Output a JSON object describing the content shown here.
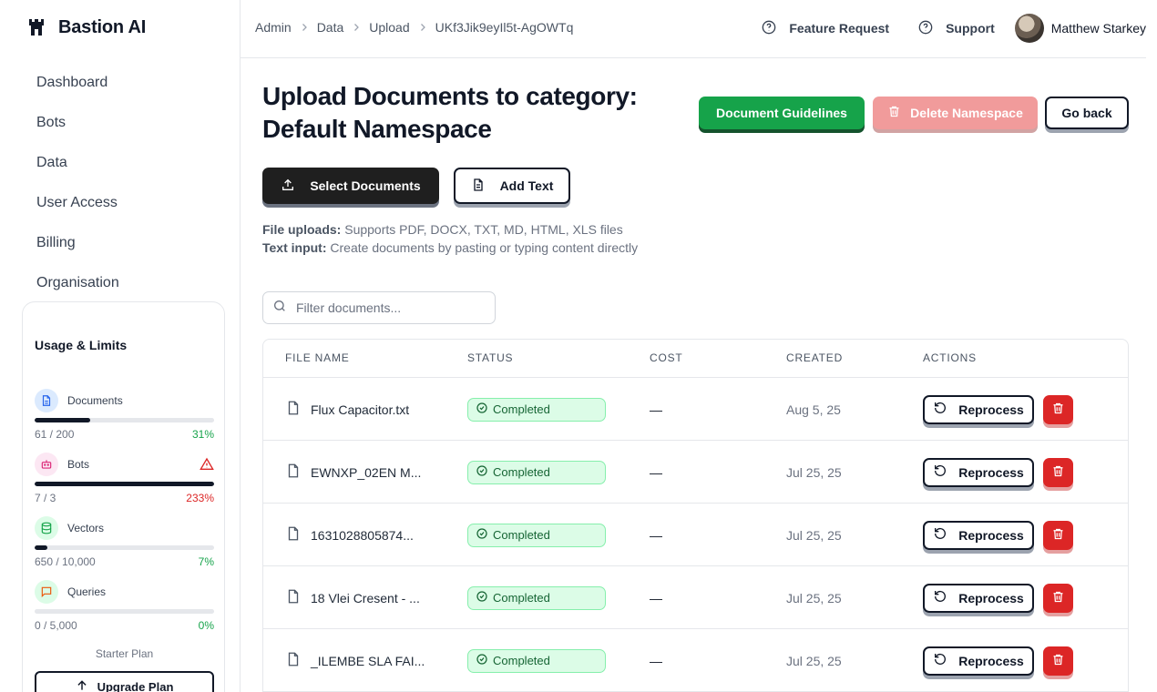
{
  "brand": {
    "name": "Bastion AI"
  },
  "nav": [
    "Dashboard",
    "Bots",
    "Data",
    "User Access",
    "Billing",
    "Organisation"
  ],
  "usage": {
    "title": "Usage & Limits",
    "metrics": [
      {
        "label": "Documents",
        "count": "61 / 200",
        "pct": "31%",
        "fill": 31,
        "icon": "document-icon",
        "warning": false
      },
      {
        "label": "Bots",
        "count": "7 / 3",
        "pct": "233%",
        "fill": 100,
        "icon": "bot-icon",
        "warning": true
      },
      {
        "label": "Vectors",
        "count": "650 / 10,000",
        "pct": "7%",
        "fill": 7,
        "icon": "database-icon",
        "warning": false
      },
      {
        "label": "Queries",
        "count": "0 / 5,000",
        "pct": "0%",
        "fill": 0,
        "icon": "chat-icon",
        "warning": false
      }
    ],
    "plan": "Starter Plan",
    "upgrade_label": "Upgrade Plan"
  },
  "breadcrumb": [
    "Admin",
    "Data",
    "Upload",
    "UKf3Jik9eyIl5t-AgOWTq"
  ],
  "header": {
    "feature_request": "Feature Request",
    "support": "Support",
    "user_name": "Matthew Starkey"
  },
  "page": {
    "title": "Upload Documents to category: Default Namespace",
    "guidelines_label": "Document Guidelines",
    "delete_label": "Delete Namespace",
    "back_label": "Go back",
    "select_label": "Select Documents",
    "add_text_label": "Add Text",
    "help_uploads_label": "File uploads:",
    "help_uploads_text": "Supports PDF, DOCX, TXT, MD, HTML, XLS files",
    "help_text_label": "Text input:",
    "help_text_text": "Create documents by pasting or typing content directly",
    "filter_placeholder": "Filter documents..."
  },
  "table": {
    "columns": [
      "FILE NAME",
      "STATUS",
      "COST",
      "CREATED",
      "ACTIONS"
    ],
    "reprocess_label": "Reprocess",
    "rows": [
      {
        "name": "Flux Capacitor.txt",
        "status": "Completed",
        "cost": "—",
        "created": "Aug 5, 25"
      },
      {
        "name": "EWNXP_02EN M...",
        "status": "Completed",
        "cost": "—",
        "created": "Jul 25, 25"
      },
      {
        "name": "1631028805874...",
        "status": "Completed",
        "cost": "—",
        "created": "Jul 25, 25"
      },
      {
        "name": "18 Vlei Cresent - ...",
        "status": "Completed",
        "cost": "—",
        "created": "Jul 25, 25"
      },
      {
        "name": "_ILEMBE SLA FAI...",
        "status": "Completed",
        "cost": "—",
        "created": "Jul 25, 25"
      }
    ]
  },
  "colors": {
    "accent_green": "#16a34a",
    "danger_red": "#dc2626",
    "delete_disabled": "#f19b9b",
    "badge_bg": "#dcfce7",
    "dark": "#1f1f1f"
  }
}
